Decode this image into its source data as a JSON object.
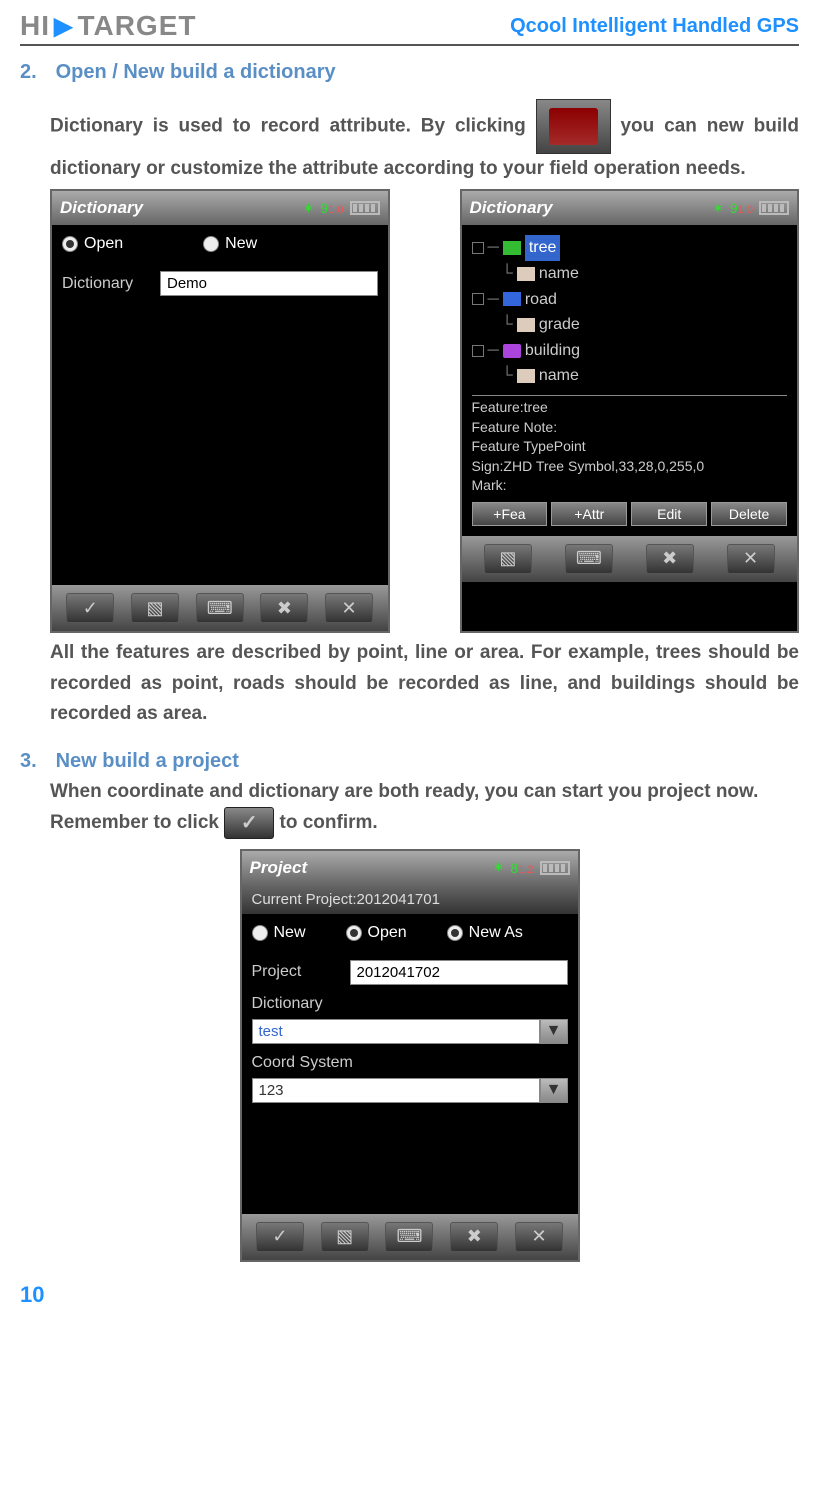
{
  "header": {
    "logo_left": "HI",
    "logo_right": "TARGET",
    "doc_title": "Qcool Intelligent Handled GPS"
  },
  "section2": {
    "num": "2.",
    "title": "Open / New build a dictionary",
    "para_before_icon": "Dictionary is used to record attribute. By clicking ",
    "para_after_icon": " you can new build dictionary or customize the attribute according to your field operation needs.",
    "para_after_screens": "All the features are described by point, line or area. For example, trees should be recorded as point, roads should be recorded as line, and buildings should be recorded as area."
  },
  "screen1": {
    "title": "Dictionary",
    "sat_num": "9",
    "sat_sub": "1.0",
    "radio_open": "Open",
    "radio_new": "New",
    "field_label": "Dictionary",
    "field_value": "Demo"
  },
  "screen2": {
    "title": "Dictionary",
    "sat_num": "9",
    "sat_sub": "1.0",
    "tree": {
      "tree_label": "tree",
      "tree_name": "name",
      "road_label": "road",
      "road_grade": "grade",
      "building_label": "building",
      "building_name": "name"
    },
    "info": {
      "feature": "Feature:tree",
      "note": "Feature Note:",
      "type": "Feature TypePoint",
      "sign": "Sign:ZHD Tree Symbol,33,28,0,255,0",
      "mark": "Mark:"
    },
    "buttons": {
      "fea": "+Fea",
      "attr": "+Attr",
      "edit": "Edit",
      "delete": "Delete"
    }
  },
  "section3": {
    "num": "3.",
    "title": "New build a project",
    "para1": "When coordinate and dictionary are both ready, you can start you project now.",
    "para2_before": "Remember to click ",
    "para2_after": " to confirm."
  },
  "screen3": {
    "title": "Project",
    "sat_num": "8",
    "sat_sub": "1.2",
    "current": "Current Project:2012041701",
    "radio_new": "New",
    "radio_open": "Open",
    "radio_newas": "New As",
    "project_label": "Project",
    "project_value": "2012041702",
    "dict_label": "Dictionary",
    "dict_value": "test",
    "coord_label": "Coord System",
    "coord_value": "123"
  },
  "page_num": "10"
}
